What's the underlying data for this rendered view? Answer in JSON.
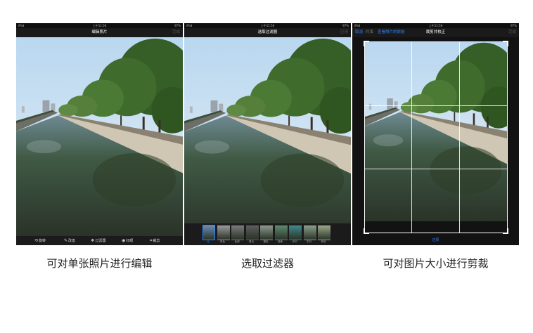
{
  "status_bar": {
    "carrier": "iPad",
    "time": "上午11:56",
    "battery": "97%"
  },
  "screens": {
    "edit": {
      "nav_title": "编辑照片",
      "nav_right": "完成",
      "tools": [
        {
          "icon": "rotate-icon",
          "label": "旋转"
        },
        {
          "icon": "enhance-icon",
          "label": "改善"
        },
        {
          "icon": "filter-icon",
          "label": "过滤器"
        },
        {
          "icon": "red-eye-icon",
          "label": "红眼"
        },
        {
          "icon": "crop-icon",
          "label": "裁剪"
        }
      ]
    },
    "filter": {
      "nav_title": "选取过滤器",
      "nav_right": "应用",
      "filters": [
        {
          "label": "无",
          "tint": "#6a8db3",
          "selected": true
        },
        {
          "label": "单色",
          "tint": "#9a9a9a"
        },
        {
          "label": "色调",
          "tint": "#7a7a7a"
        },
        {
          "label": "黑白",
          "tint": "#5c5c5c"
        },
        {
          "label": "褪色",
          "tint": "#8c9a8c"
        },
        {
          "label": "铬黄",
          "tint": "#5d8a6e"
        },
        {
          "label": "冲印",
          "tint": "#3f8a8c"
        },
        {
          "label": "岁月",
          "tint": "#8aa08c"
        },
        {
          "label": "怀旧",
          "tint": "#9aa888"
        }
      ]
    },
    "crop": {
      "nav_left": "取消",
      "nav_left_2": "约束",
      "nav_left_3": "查看照片的原始",
      "nav_title": "裁剪并校正",
      "nav_right": "完成",
      "bottom_label": "还原"
    }
  },
  "captions": [
    "可对单张照片进行编辑",
    "选取过滤器",
    "可对图片大小进行剪裁"
  ],
  "colors": {
    "accent": "#2f86ff",
    "toolbar": "#1b1b1b",
    "sky": "#cfe3f3",
    "trees": "#3f6b2c",
    "water": "#3d4a37"
  }
}
